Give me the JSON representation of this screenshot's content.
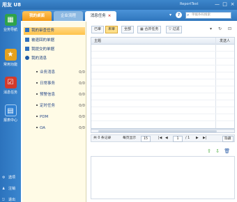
{
  "window": {
    "title": "用友 U8",
    "center_text": "ReportTest",
    "buttons": [
      "—",
      "□",
      "×"
    ]
  },
  "tabs": [
    {
      "label": "我的桌面",
      "active": false
    },
    {
      "label": "企业流程",
      "active": false
    },
    {
      "label": "消息任务",
      "active": true,
      "close": "×"
    }
  ],
  "topbar": {
    "more": "▾",
    "help": "?",
    "search_placeholder": "单据条码搜索"
  },
  "sidebar": {
    "items": [
      {
        "label": "业务导航",
        "icon": "grid-icon"
      },
      {
        "label": "常用功能",
        "icon": "star-icon"
      },
      {
        "label": "消息任务",
        "icon": "task-icon"
      },
      {
        "label": "报表中心",
        "icon": "report-icon"
      }
    ],
    "bottom": [
      {
        "label": "选项",
        "icon": "gear-icon"
      },
      {
        "label": "注销",
        "icon": "user-icon"
      },
      {
        "label": "退出",
        "icon": "exit-icon"
      }
    ]
  },
  "tree": {
    "items": [
      {
        "label": "我的审查任务",
        "selected": true
      },
      {
        "label": "被退回的单据",
        "selected": false
      },
      {
        "label": "我提交的单据",
        "selected": false
      },
      {
        "label": "我的消息",
        "selected": false
      }
    ],
    "sub_items": [
      {
        "label": "业务消息",
        "count": "0/0"
      },
      {
        "label": "日常事务",
        "count": "0/0"
      },
      {
        "label": "预警信息",
        "count": "0/0"
      },
      {
        "label": "定时任务",
        "count": "0/0"
      },
      {
        "label": "PDM",
        "count": "0/0"
      },
      {
        "label": "OA",
        "count": "0/0"
      }
    ]
  },
  "toolbar": {
    "buttons": [
      "已审",
      "未审",
      "全部",
      "合并任务",
      "过滤"
    ],
    "right_icons": [
      "▾",
      "↻",
      "⊡"
    ]
  },
  "grid": {
    "columns": [
      "主题",
      "发送人"
    ]
  },
  "pager": {
    "total": "共 0 条记录",
    "page_size_label": "每页显示",
    "page_size": "15",
    "first": "|◀",
    "prev": "◀",
    "page": "1",
    "of_pages": "/ 1",
    "next": "▶",
    "last": "▶|",
    "hide": "隐藏"
  },
  "detail_actions": {
    "up": "⇧",
    "down": "⇩",
    "delete": "🗑"
  }
}
